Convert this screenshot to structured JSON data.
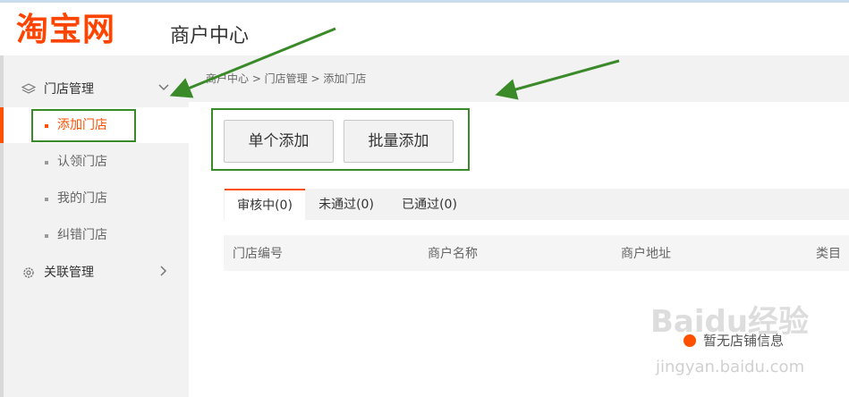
{
  "header": {
    "logo": "淘宝网",
    "title": "商户中心"
  },
  "sidebar": {
    "groups": [
      {
        "label": "门店管理",
        "icon": "layers-icon",
        "arrow": "chevron-down-icon"
      },
      {
        "label": "关联管理",
        "icon": "gear-icon",
        "arrow": "chevron-right-icon"
      }
    ],
    "items": [
      {
        "label": "添加门店",
        "active": true
      },
      {
        "label": "认领门店"
      },
      {
        "label": "我的门店"
      },
      {
        "label": "纠错门店"
      }
    ]
  },
  "breadcrumb": "商户中心 > 门店管理 > 添加门店",
  "actions": {
    "single_add": "单个添加",
    "batch_add": "批量添加"
  },
  "tabs": [
    {
      "label": "审核中(0)",
      "active": true
    },
    {
      "label": "未通过(0)"
    },
    {
      "label": "已通过(0)"
    }
  ],
  "table": {
    "columns": [
      "门店编号",
      "商户名称",
      "商户地址",
      "类目"
    ]
  },
  "empty_text": "暂无店铺信息",
  "watermark": {
    "logo": "Baidu经验",
    "url": "jingyan.baidu.com"
  },
  "colors": {
    "brand": "#ff4400",
    "accent": "#ff5000",
    "annotation": "#3a8a2a"
  }
}
